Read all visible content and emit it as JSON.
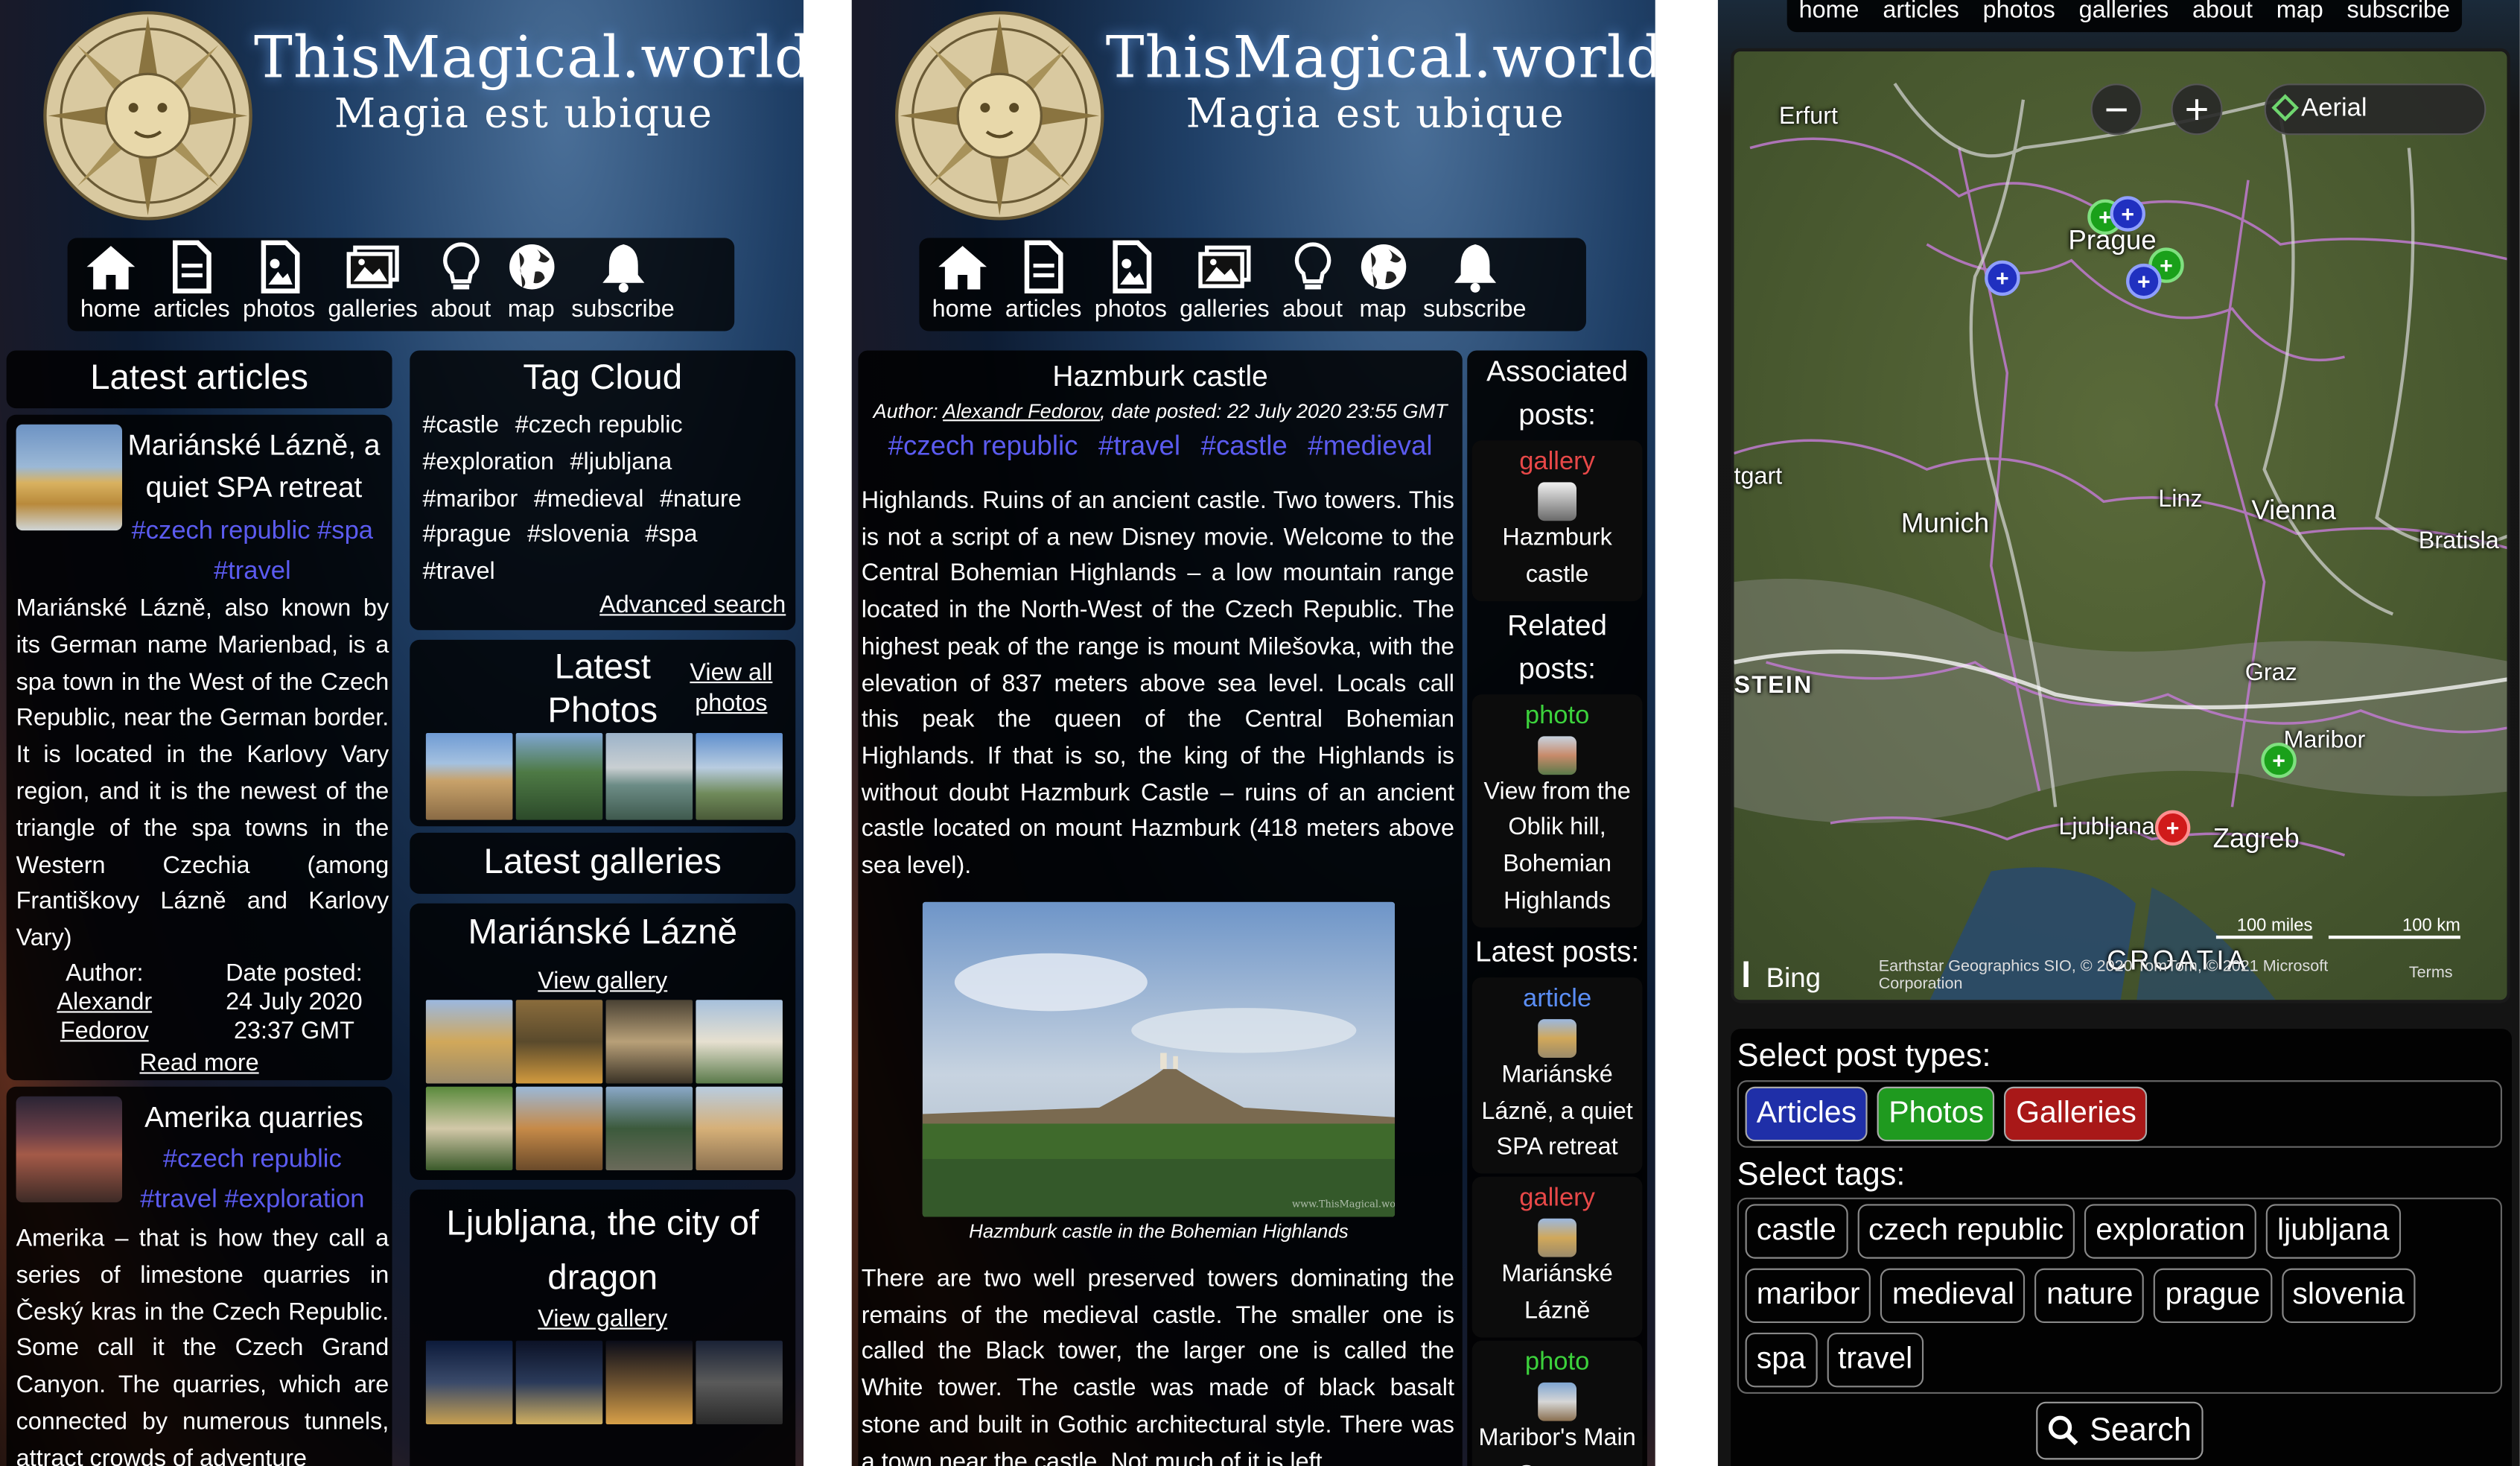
{
  "site": {
    "title": "ThisMagical.world",
    "motto": "Magia est ubique"
  },
  "nav": [
    {
      "label": "home",
      "icon": "home-icon"
    },
    {
      "label": "articles",
      "icon": "document-icon"
    },
    {
      "label": "photos",
      "icon": "photo-icon"
    },
    {
      "label": "galleries",
      "icon": "gallery-icon"
    },
    {
      "label": "about",
      "icon": "lightbulb-icon"
    },
    {
      "label": "map",
      "icon": "globe-icon"
    },
    {
      "label": "subscribe",
      "icon": "bell-icon"
    }
  ],
  "latest_articles": {
    "title": "Latest articles",
    "items": [
      {
        "title": "Mariánské Lázně, a quiet SPA retreat",
        "tags": [
          "#czech republic",
          "#spa",
          "#travel"
        ],
        "excerpt": "Mariánské Lázně, also known by its German name Marienbad, is a spa town in the West of the Czech Republic, near the German border. It is located in the Karlovy Vary region, and it is the newest of the triangle of the spa towns in the Western Czechia (among Františkovy Lázně and Karlovy Vary)",
        "author_label": "Author:",
        "author": "Alexandr Fedorov",
        "date_label": "Date posted:",
        "date": "24 July 2020",
        "time": "23:37 GMT",
        "read_more": "Read more"
      },
      {
        "title": "Amerika quarries",
        "tags": [
          "#czech republic",
          "#travel",
          "#exploration"
        ],
        "excerpt": "Amerika – that is how they call a series of limestone quarries in Český kras in the Czech Republic. Some call it the Czech Grand Canyon. The quarries, which are connected by numerous tunnels, attract crowds of adventure"
      }
    ]
  },
  "tag_cloud": {
    "title": "Tag Cloud",
    "tags": [
      "#castle",
      "#czech republic",
      "#exploration",
      "#ljubljana",
      "#maribor",
      "#medieval",
      "#nature",
      "#prague",
      "#slovenia",
      "#spa",
      "#travel"
    ],
    "advanced_search": "Advanced search"
  },
  "latest_photos": {
    "title": "Latest Photos",
    "view_all": "View all photos"
  },
  "latest_galleries": {
    "title": "Latest galleries",
    "items": [
      {
        "title": "Mariánské Lázně",
        "link": "View gallery"
      },
      {
        "title": "Ljubljana, the city of dragon",
        "link": "View gallery"
      }
    ]
  },
  "post": {
    "title": "Hazmburk castle",
    "author_prefix": "Author: ",
    "author": "Alexandr Fedorov",
    "date_text": ", date posted: 22 July 2020 23:55 GMT",
    "tags": [
      "#czech republic",
      "#travel",
      "#castle",
      "#medieval"
    ],
    "paragraph1": "Highlands. Ruins of an ancient castle. Two towers. This is not a script of a new Disney movie. Welcome to the Central Bohemian Highlands – a low mountain range located in the North-West of the Czech Republic. The highest peak of the range is mount Milešovka, with the elevation of 837 meters above sea level. Locals call this peak the queen of the Central Bohemian Highlands. If that is so, the king of the Highlands is without doubt Hazmburk Castle – ruins of an ancient castle located on mount Hazmburk (418 meters above sea level).",
    "watermark": "www.ThisMagical.world",
    "caption": "Hazmburk castle in the Bohemian Highlands",
    "paragraph2": "There are two well preserved towers dominating the remains of the medieval castle. The smaller one is called the Black tower, the larger one is called the White tower. The castle was made of black basalt stone and built in Gothic architectural style. There was a town near the castle. Not much of it is left"
  },
  "side": {
    "associated_title": "Associated posts:",
    "associated": [
      {
        "type": "gallery",
        "name": "Hazmburk castle",
        "color": "#e84848"
      }
    ],
    "related_title": "Related posts:",
    "related": [
      {
        "type": "photo",
        "name": "View from the Oblik hill, Bohemian Highlands",
        "color": "#3cd23c"
      }
    ],
    "latest_title": "Latest posts:",
    "latest": [
      {
        "type": "article",
        "name": "Mariánské Lázně, a quiet SPA retreat",
        "color": "#5b8ef5"
      },
      {
        "type": "gallery",
        "name": "Mariánské Lázně",
        "color": "#e84848"
      },
      {
        "type": "photo",
        "name": "Maribor's Main Square",
        "color": "#3cd23c"
      }
    ]
  },
  "map_page": {
    "nav": [
      "home",
      "articles",
      "photos",
      "galleries",
      "about",
      "map",
      "subscribe"
    ],
    "zoom_out": "−",
    "zoom_in": "+",
    "layer": "Aerial",
    "cities": {
      "erfurt": "Erfurt",
      "prague": "Prague",
      "stuttgart": "tgart",
      "munich": "Munich",
      "linz": "Linz",
      "vienna": "Vienna",
      "bratislava": "Bratisla",
      "stein": "STEIN",
      "graz": "Graz",
      "maribor": "Maribor",
      "ljubljana": "Ljubljana",
      "zagreb": "Zagreb",
      "croatia": "CROATIA"
    },
    "bing": "Bing",
    "scale_miles": "100 miles",
    "scale_km": "100 km",
    "attribution": "Earthstar Geographics SIO, © 2020 TomTom, © 2021 Microsoft Corporation",
    "terms": "Terms",
    "select_types_label": "Select post types:",
    "types": [
      {
        "label": "Articles",
        "color": "#1f2fa8"
      },
      {
        "label": "Photos",
        "color": "#1f9a1f"
      },
      {
        "label": "Galleries",
        "color": "#a81818"
      }
    ],
    "select_tags_label": "Select tags:",
    "tags": [
      "castle",
      "czech republic",
      "exploration",
      "ljubljana",
      "maribor",
      "medieval",
      "nature",
      "prague",
      "slovenia",
      "spa",
      "travel"
    ],
    "search": "Search"
  }
}
